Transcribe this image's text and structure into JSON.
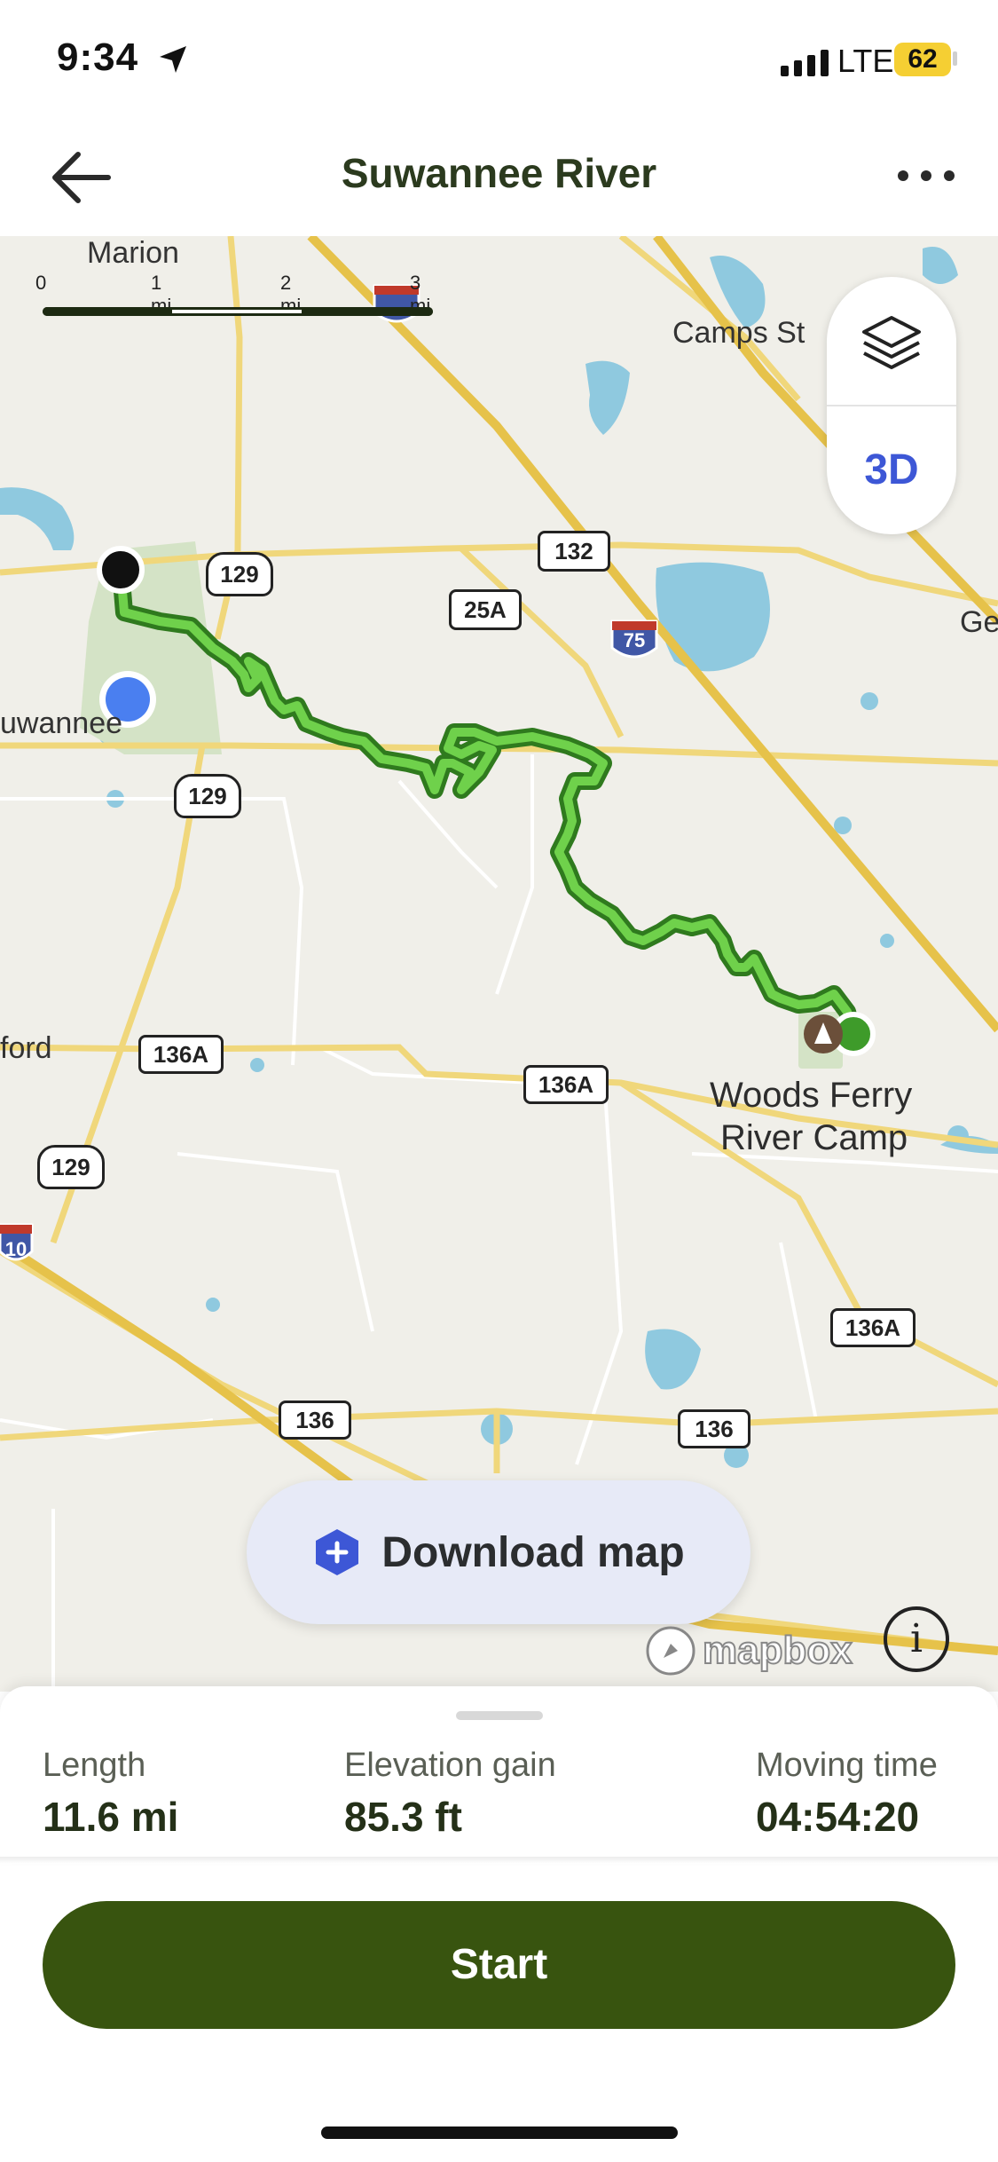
{
  "status_bar": {
    "time": "9:34",
    "network": "LTE",
    "battery": "62"
  },
  "header": {
    "title": "Suwannee River"
  },
  "map": {
    "scale": {
      "labels": [
        "0",
        "1 mi",
        "2 mi",
        "3 mi"
      ]
    },
    "places": [
      {
        "name": "Marion"
      },
      {
        "name": "Camps St"
      },
      {
        "name": "Ge"
      },
      {
        "name": "uwannee"
      },
      {
        "name": "ford"
      },
      {
        "name": "Woods Ferry"
      },
      {
        "name": "River Camp"
      }
    ],
    "road_shields": [
      "129",
      "132",
      "25A",
      "75",
      "129",
      "136A",
      "136A",
      "129",
      "10",
      "136A",
      "136",
      "136"
    ],
    "controls": {
      "threed_label": "3D"
    },
    "download_label": "Download map",
    "attribution": "mapbox"
  },
  "stats": {
    "length": {
      "label": "Length",
      "value": "11.6 mi"
    },
    "elevation": {
      "label": "Elevation gain",
      "value": "85.3 ft"
    },
    "moving_time": {
      "label": "Moving time",
      "value": "04:54:20"
    }
  },
  "actions": {
    "start_label": "Start"
  },
  "colors": {
    "trail": "#5cbf3a",
    "trail_outline": "#2f7a1e",
    "start_button": "#38540f",
    "accent_3d": "#3d57d6",
    "user_location": "#4a7ff0"
  }
}
